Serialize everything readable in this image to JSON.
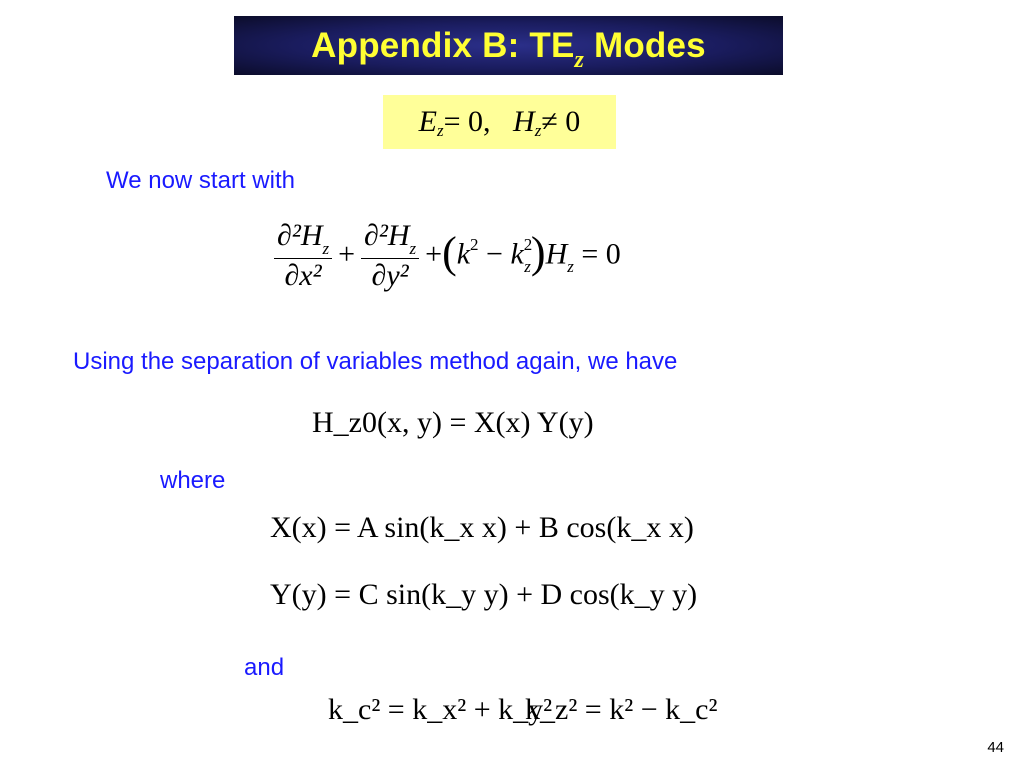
{
  "slide": {
    "title_main": "Appendix B: TE",
    "title_sub": "z",
    "title_tail": " Modes",
    "condition": {
      "ez": "E",
      "ez_sub": "z",
      "ez_rel": " = 0,",
      "hz": "H",
      "hz_sub": "z",
      "hz_rel": " ≠ 0"
    },
    "text1": "We now start with",
    "wave_eq": {
      "num1": "∂²H",
      "num1_sub": "z",
      "den1": "∂x²",
      "num2": "∂²H",
      "num2_sub": "z",
      "den2": "∂y²",
      "rest_k": "k",
      "rest_kz": "k",
      "rest_kz_sub": "z",
      "rest_h": "H",
      "rest_h_sub": "z",
      "rhs": "= 0"
    },
    "text2": "Using the separation of variables method again, we have",
    "separation_eq": "H_z0(x, y) = X(x) Y(y)",
    "text3": "where",
    "x_eq": "X(x) = A sin(k_x x) + B cos(k_x x)",
    "y_eq": "Y(y) = C sin(k_y y) + D cos(k_y y)",
    "text4": "and",
    "kc_eq": "k_c² = k_x² + k_y²",
    "kz_eq": "k_z² = k² − k_c²",
    "page_number": "44"
  },
  "colors": {
    "title_text": "#ffff33",
    "title_bg": "#1a1c5e",
    "body_text": "#1a1aff",
    "highlight": "#ffff99"
  }
}
